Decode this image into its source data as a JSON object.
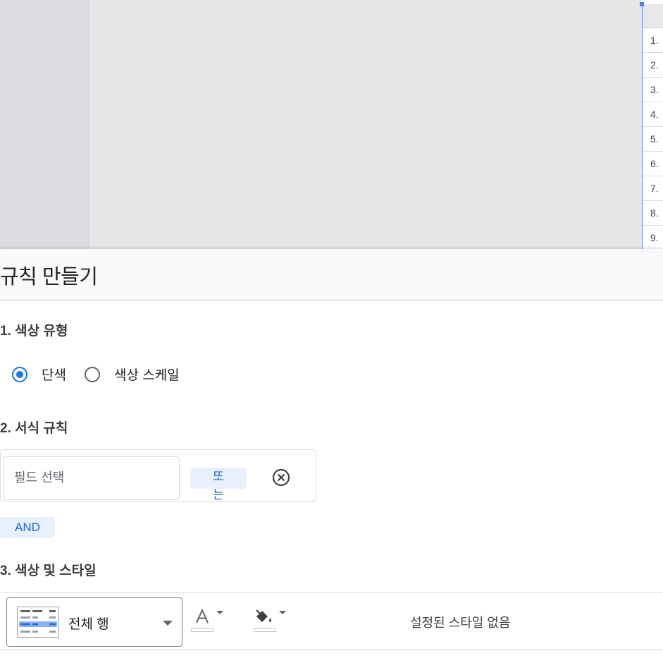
{
  "table": {
    "row_numbers": [
      "1.",
      "2.",
      "3.",
      "4.",
      "5.",
      "6.",
      "7.",
      "8.",
      "9."
    ]
  },
  "panel": {
    "title": "규칙 만들기",
    "section1": {
      "title": "1. 색상 유형",
      "options": [
        {
          "label": "단색",
          "checked": true
        },
        {
          "label": "색상 스케일",
          "checked": false
        }
      ]
    },
    "section2": {
      "title": "2. 서식 규칙",
      "field_placeholder": "필드 선택",
      "or_label": "또는",
      "and_label": "AND"
    },
    "section3": {
      "title": "3. 색상 및 스타일",
      "scope_label": "전체 행",
      "no_style_label": "설정된 스타일 없음"
    }
  },
  "colors": {
    "accent": "#1a73e8",
    "chip_bg": "#e8f0fe",
    "chip_text": "#1967d2"
  }
}
